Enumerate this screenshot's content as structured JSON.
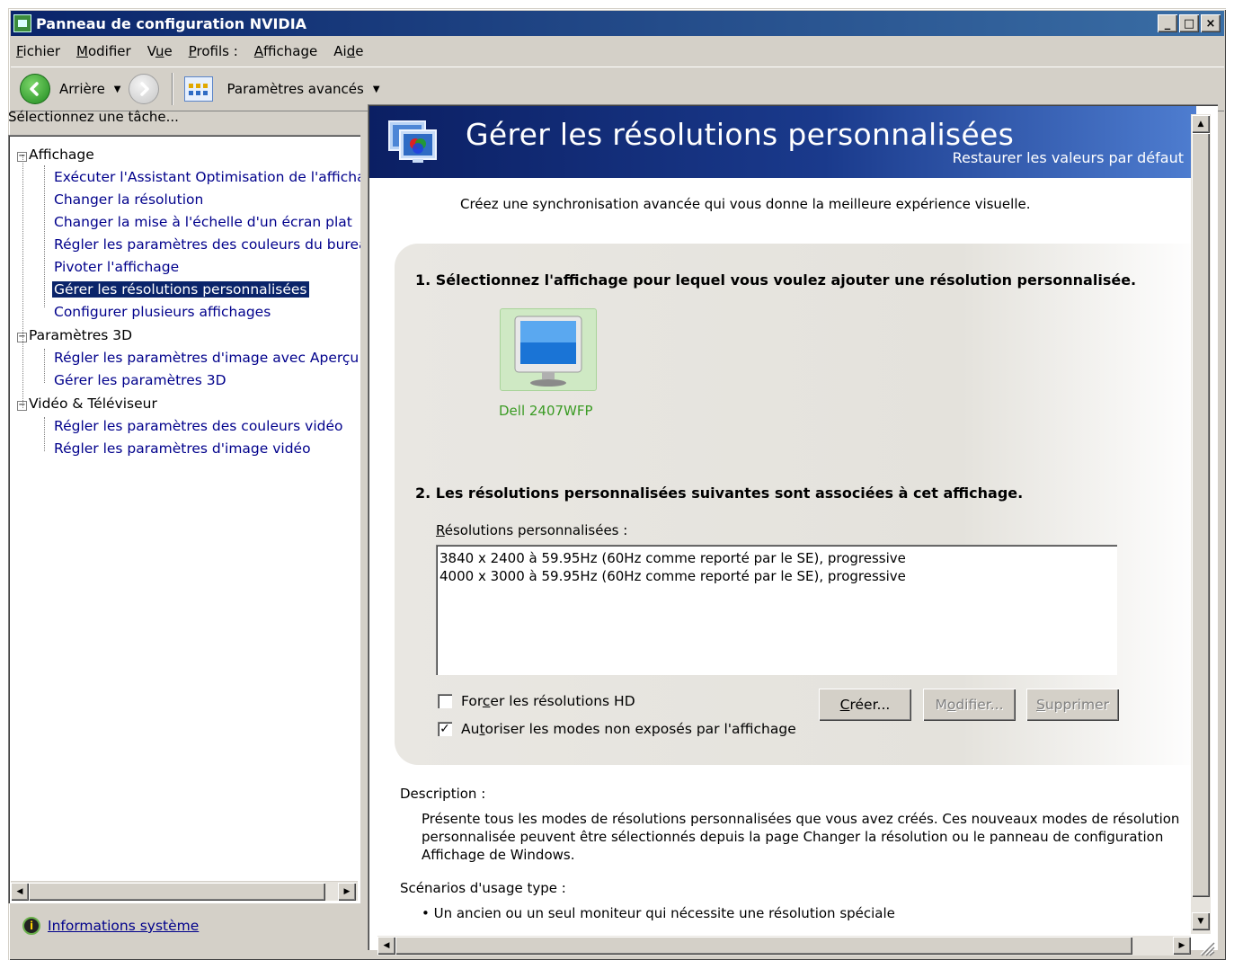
{
  "window": {
    "title": "Panneau de configuration NVIDIA",
    "controls": {
      "minimize": "_",
      "maximize": "□",
      "close": "×"
    }
  },
  "menubar": {
    "items": [
      {
        "label_first": "F",
        "label_rest": "ichier"
      },
      {
        "label_first": "M",
        "label_rest": "odifier"
      },
      {
        "label_pre": "V",
        "label_ul": "u",
        "label_post": "e"
      },
      {
        "label_first": "P",
        "label_rest": "rofils :"
      },
      {
        "label_first": "A",
        "label_rest": "ffichage"
      },
      {
        "label_pre": "Ai",
        "label_ul": "d",
        "label_post": "e"
      }
    ]
  },
  "toolbar": {
    "back_label": "Arrière",
    "advanced_label": "Paramètres avancés"
  },
  "left": {
    "header": "Sélectionnez une tâche...",
    "tree": {
      "affichage": "Affichage",
      "affichage_items": [
        "Exécuter l'Assistant Optimisation de l'affichag",
        "Changer la résolution",
        "Changer la mise à l'échelle d'un écran plat",
        "Régler les paramètres des couleurs du burea",
        "Pivoter l'affichage",
        "Gérer les résolutions personnalisées",
        "Configurer plusieurs affichages"
      ],
      "params3d": "Paramètres 3D",
      "params3d_items": [
        "Régler les paramètres d'image avec Aperçu",
        "Gérer les paramètres 3D"
      ],
      "video": "Vidéo & Téléviseur",
      "video_items": [
        "Régler les paramètres des couleurs vidéo",
        "Régler les paramètres d'image vidéo"
      ]
    },
    "sysinfo": "Informations système"
  },
  "main": {
    "title": "Gérer les résolutions personnalisées",
    "restore": "Restaurer les valeurs par défaut",
    "intro": "Créez une synchronisation avancée qui vous donne la meilleure expérience visuelle.",
    "step1": "1. Sélectionnez l'affichage pour lequel vous voulez ajouter une résolution personnalisée.",
    "monitor_name": "Dell 2407WFP",
    "step2": "2. Les résolutions personnalisées suivantes sont associées à cet affichage.",
    "list_label_first": "R",
    "list_label_rest": "ésolutions personnalisées :",
    "resolutions": [
      "3840 x 2400 à 59.95Hz (60Hz comme reporté par le SE), progressive",
      "4000 x 3000 à 59.95Hz (60Hz comme reporté par le SE), progressive"
    ],
    "force_hd": {
      "pre": "For",
      "ul": "c",
      "post": "er les résolutions HD",
      "checked": false
    },
    "allow_modes": {
      "pre": "Au",
      "ul": "t",
      "post": "oriser les modes non exposés par l'affichage",
      "checked": true,
      "mark": "✓"
    },
    "buttons": {
      "create": {
        "ul": "C",
        "rest": "réer..."
      },
      "modify": {
        "pre": "M",
        "ul": "o",
        "rest": "difier..."
      },
      "delete": {
        "ul": "S",
        "rest": "upprimer"
      }
    },
    "description_label": "Description :",
    "description": "Présente tous les modes de résolutions personnalisées que vous avez créés. Ces nouveaux modes de résolution personnalisée peuvent être sélectionnés depuis la page Changer la résolution ou le panneau de configuration Affichage de Windows.",
    "usage_label": "Scénarios d'usage type :",
    "usage_items": [
      "• Un ancien ou un seul moniteur qui nécessite une résolution spéciale"
    ]
  },
  "colors": {
    "title_bar": "#0a246a",
    "banner": "#1a3a8c",
    "selection": "#0a246a",
    "link": "#00008b",
    "monitor_label": "#3a9b23"
  }
}
